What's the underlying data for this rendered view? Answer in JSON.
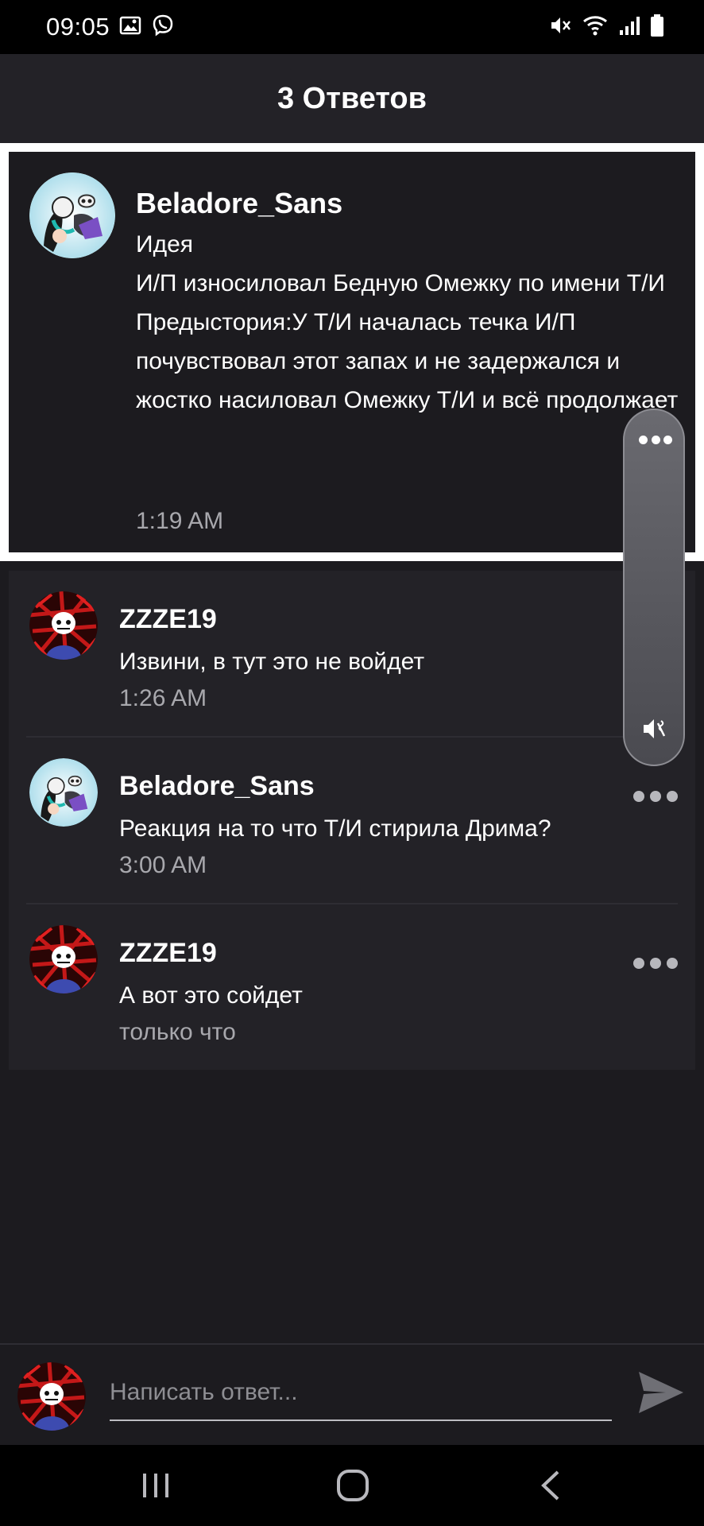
{
  "status_bar": {
    "time": "09:05"
  },
  "header": {
    "title": "3 Ответов"
  },
  "parent_comment": {
    "author": "Beladore_Sans",
    "text": "Идея\nИ/П износиловал Бедную Омежку по имени Т/И\nПредыстория:У Т/И началась течка И/П почувствовал этот запах и не задержался и жостко насиловал Омежку Т/И  и всё продолжает",
    "time": "1:19 AM"
  },
  "replies": [
    {
      "author": "ZZZE19",
      "text": "Извини, в тут это не войдет",
      "time": "1:26 AM"
    },
    {
      "author": "Beladore_Sans",
      "text": "Реакция на то что Т/И стирила Дрима?",
      "time": "3:00 AM"
    },
    {
      "author": "ZZZE19",
      "text": "А вот это сойдет",
      "time": "только что"
    }
  ],
  "composer": {
    "placeholder": "Написать ответ..."
  },
  "colors": {
    "background": "#1c1b1f",
    "header": "#232227",
    "highlight_border": "#ffffff",
    "secondary_text": "#a8a8ad"
  }
}
